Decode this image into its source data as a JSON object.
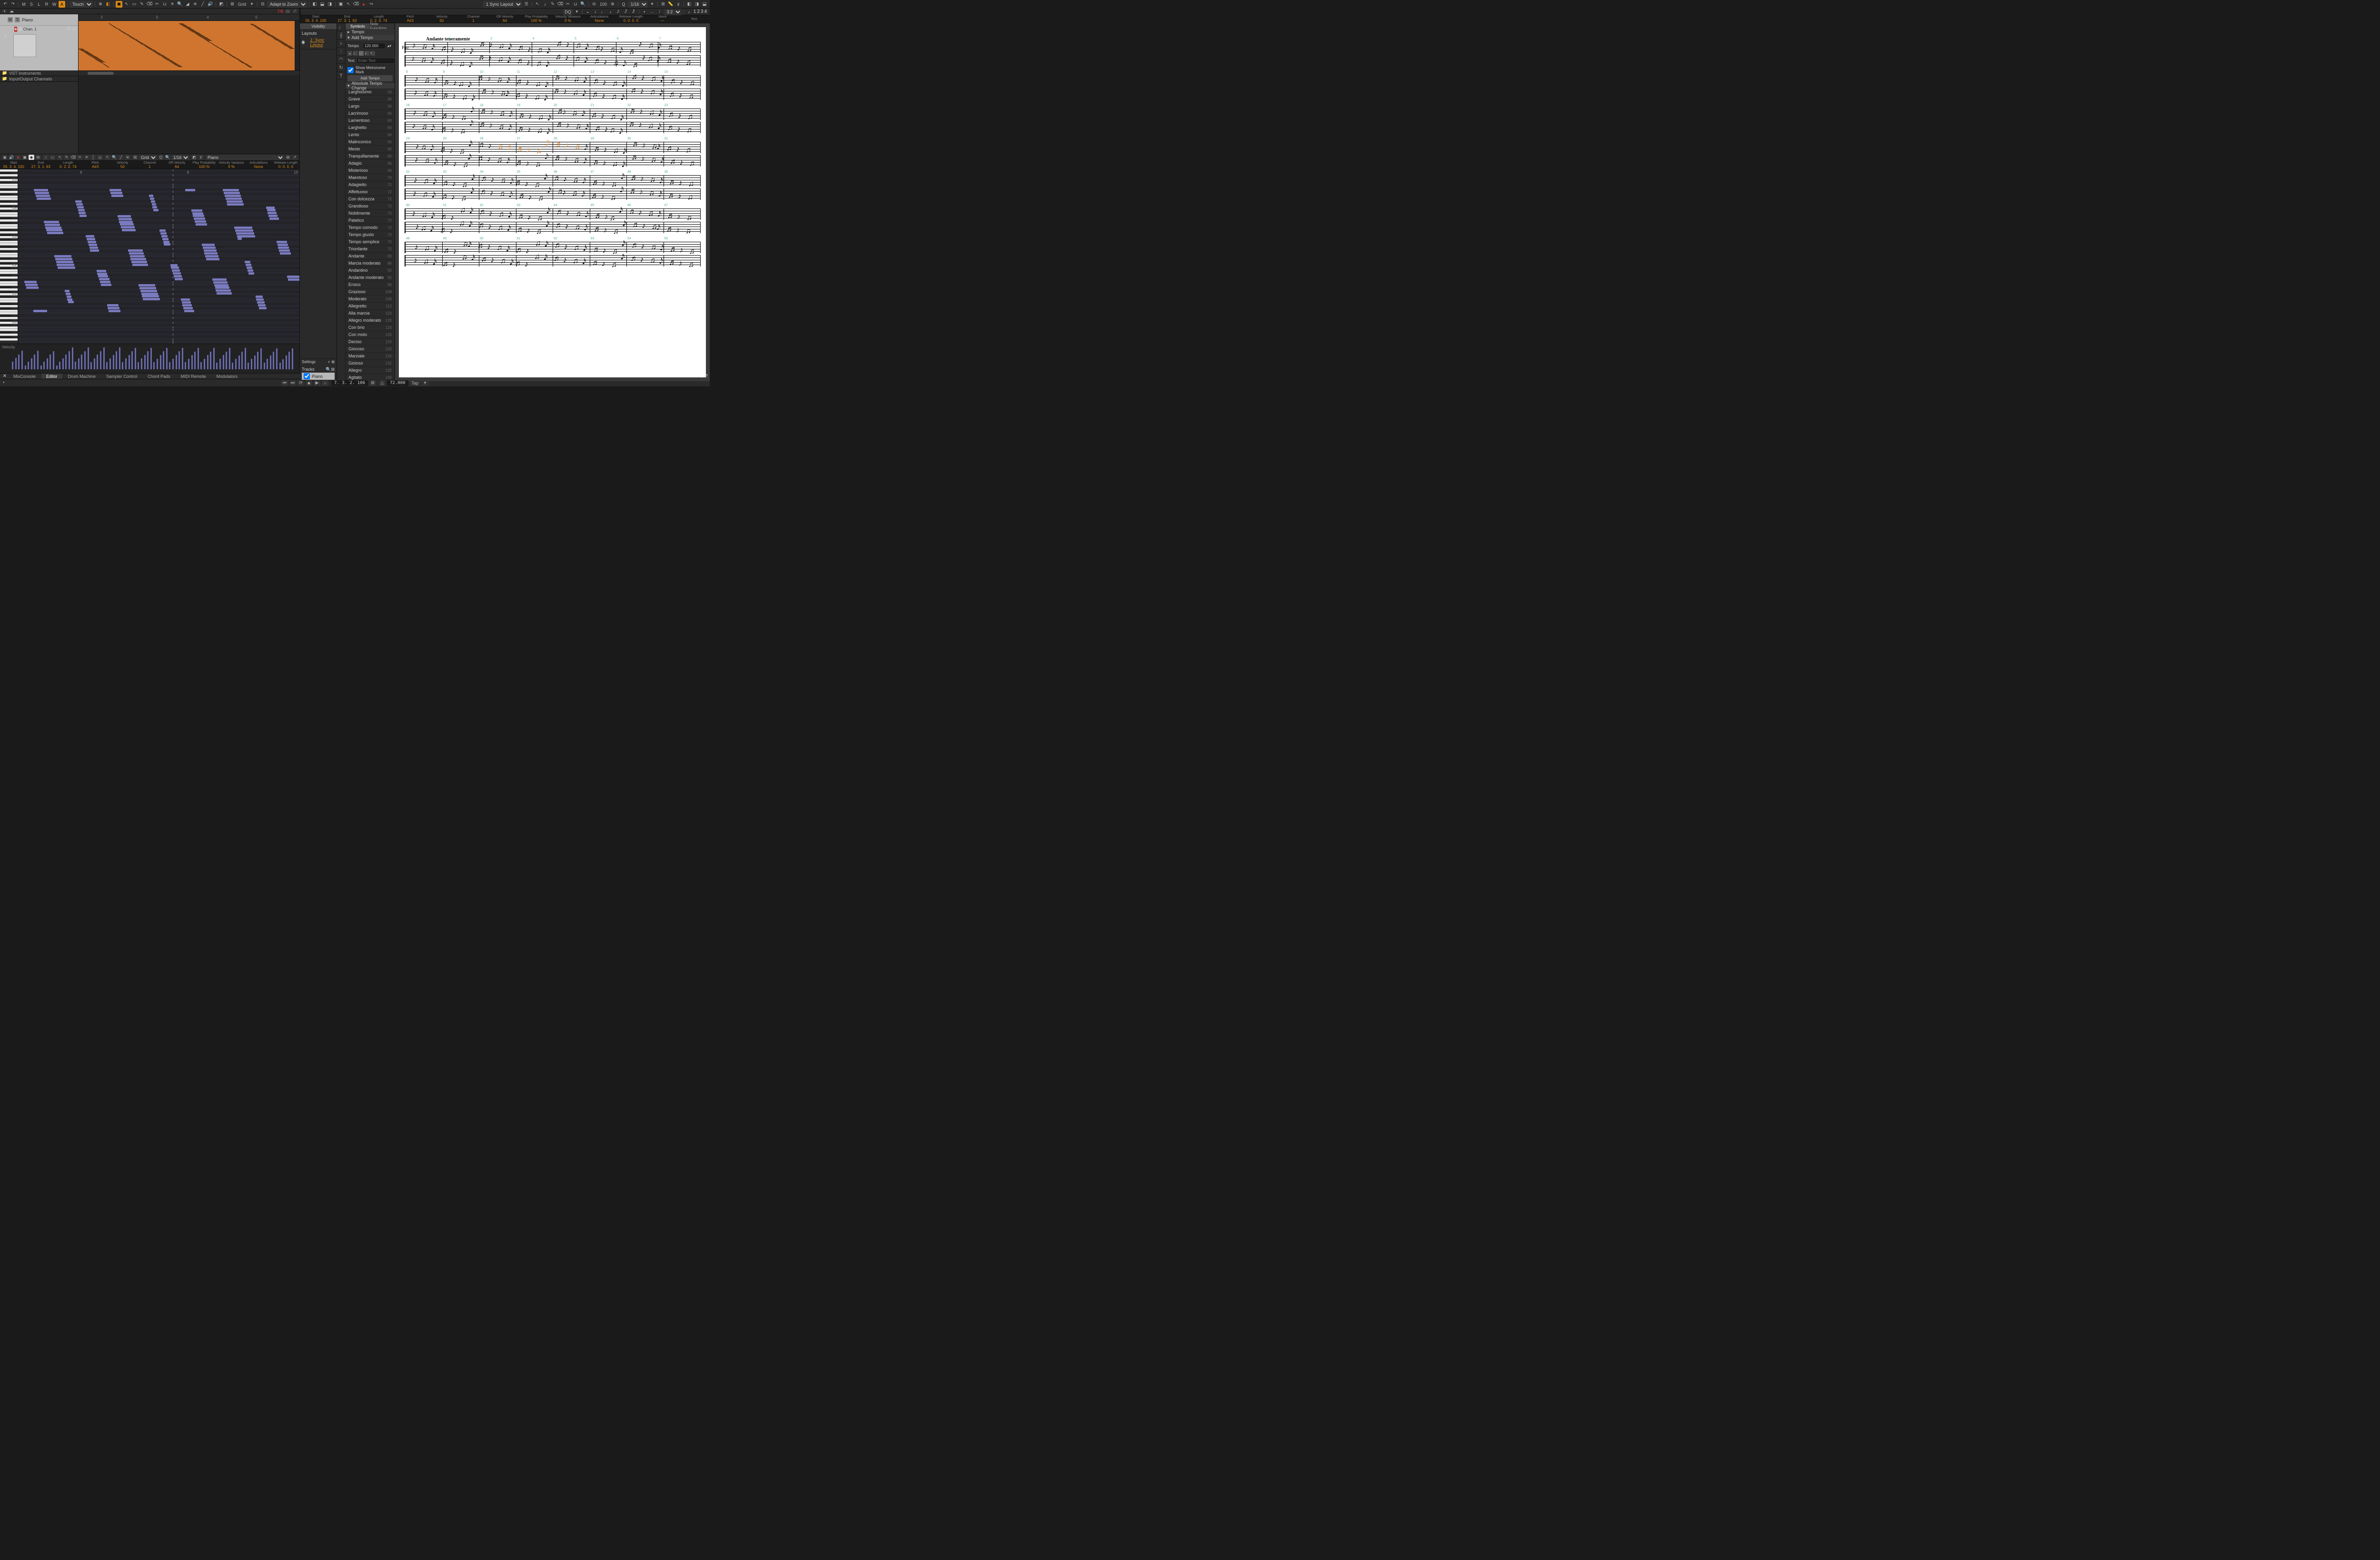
{
  "toolbar_top": {
    "automation_mode": "Touch",
    "grid_label": "Grid",
    "adapt_zoom": "Adapt to Zoom",
    "sync_layout": "1 Sync Layout",
    "zoom_pct": "100",
    "quantize": "1/16",
    "dq_label": "DQ",
    "triplet": "3:2",
    "voices": [
      "1",
      "2",
      "3",
      "4"
    ]
  },
  "arranger": {
    "time_sig": "7/8",
    "track_name": "Piano",
    "channel": "Chan. 1",
    "folders": [
      "VST Instruments",
      "Input/Output Channels"
    ],
    "ruler_marks": [
      "2",
      "3",
      "4",
      "5"
    ]
  },
  "key_editor": {
    "grid_label": "Grid",
    "quantize": "1/16",
    "track_sel": "Piano",
    "info": [
      {
        "lbl": "Start",
        "val": "26.  3.  4. 100"
      },
      {
        "lbl": "End",
        "val": "27.  3.  1.  63"
      },
      {
        "lbl": "Length",
        "val": "0.  2.  0.  74"
      },
      {
        "lbl": "Pitch",
        "val": "A#3"
      },
      {
        "lbl": "Velocity",
        "val": "50"
      },
      {
        "lbl": "Channel",
        "val": "1"
      },
      {
        "lbl": "Off Velocity",
        "val": "64"
      },
      {
        "lbl": "Play Probability",
        "val": "100 %"
      },
      {
        "lbl": "Velocity Variance",
        "val": "0 %"
      },
      {
        "lbl": "Articulations",
        "val": "None"
      },
      {
        "lbl": "Release Length",
        "val": "0.  0.  0.   0"
      }
    ],
    "octaves": [
      "C5",
      "C4",
      "C3",
      "C2",
      "C1",
      "C0"
    ],
    "ruler_marks": [
      "8",
      "9",
      "10"
    ],
    "velocity_label": "Velocity"
  },
  "score": {
    "info": [
      {
        "lbl": "Start",
        "val": "26.  3.  4. 100"
      },
      {
        "lbl": "End",
        "val": "27.  3.  1.  63"
      },
      {
        "lbl": "Length",
        "val": "0.  2.  0.  74"
      },
      {
        "lbl": "Pitch",
        "val": "A#3"
      },
      {
        "lbl": "Velocity",
        "val": "50"
      },
      {
        "lbl": "Channel",
        "val": "1"
      },
      {
        "lbl": "Off Velocity",
        "val": "64"
      },
      {
        "lbl": "Play Probability",
        "val": "100 %"
      },
      {
        "lbl": "Velocity Variance",
        "val": "0 %"
      },
      {
        "lbl": "Articulations",
        "val": "None"
      },
      {
        "lbl": "Release Length",
        "val": "0.  0.  0.   0"
      },
      {
        "lbl": "Voice",
        "val": "—"
      },
      {
        "lbl": "Text",
        "val": ""
      }
    ],
    "left": {
      "tab_visibility": "Visibility",
      "tab_symbols": "Symbols",
      "tab_notefn": "Note Functions",
      "layouts_label": "Layouts",
      "layout_current": "1: Sync Layout",
      "settings_label": "Settings",
      "tracks_label": "Tracks",
      "track_item": "Piano",
      "tempo_header": "Tempo",
      "add_tempo": "Add Tempo",
      "tempo_label": "Tempo",
      "tempo_value": "120.000",
      "text_label": "Text",
      "text_placeholder": "Enter Text",
      "show_metronome": "Show Metronome Mark",
      "add_tempo_btn": "Add Tempo",
      "abs_tempo_change": "Absolute Tempo Change"
    },
    "tempo_list": [
      {
        "name": "Larghissimo",
        "bpm": 24
      },
      {
        "name": "Grave",
        "bpm": 36
      },
      {
        "name": "Largo",
        "bpm": 56
      },
      {
        "name": "Lacrimoso",
        "bpm": 60
      },
      {
        "name": "Lamentoso",
        "bpm": 60
      },
      {
        "name": "Larghetto",
        "bpm": 60
      },
      {
        "name": "Lento",
        "bpm": 60
      },
      {
        "name": "Malinconico",
        "bpm": 60
      },
      {
        "name": "Mesto",
        "bpm": 60
      },
      {
        "name": "Tranquillamente",
        "bpm": 60
      },
      {
        "name": "Adagio",
        "bpm": 66
      },
      {
        "name": "Misterioso",
        "bpm": 66
      },
      {
        "name": "Maestoso",
        "bpm": 70
      },
      {
        "name": "Adagietto",
        "bpm": 72
      },
      {
        "name": "Affettuoso",
        "bpm": 72
      },
      {
        "name": "Con dolcezza",
        "bpm": 72
      },
      {
        "name": "Grandioso",
        "bpm": 72
      },
      {
        "name": "Nobilmente",
        "bpm": 72
      },
      {
        "name": "Patetico",
        "bpm": 72
      },
      {
        "name": "Tempo comodo",
        "bpm": 72
      },
      {
        "name": "Tempo giusto",
        "bpm": 72
      },
      {
        "name": "Tempo semplice",
        "bpm": 72
      },
      {
        "name": "Trionfante",
        "bpm": 72
      },
      {
        "name": "Andante",
        "bpm": 80
      },
      {
        "name": "Marcia moderato",
        "bpm": 86
      },
      {
        "name": "Andantino",
        "bpm": 92
      },
      {
        "name": "Andante moderato",
        "bpm": 92
      },
      {
        "name": "Eroico",
        "bpm": 96
      },
      {
        "name": "Grazioso",
        "bpm": 108
      },
      {
        "name": "Moderato",
        "bpm": 108
      },
      {
        "name": "Allegretto",
        "bpm": 112
      },
      {
        "name": "Alla marcia",
        "bpm": 120
      },
      {
        "name": "Allegro moderato",
        "bpm": 120
      },
      {
        "name": "Con brio",
        "bpm": 120
      },
      {
        "name": "Con moto",
        "bpm": 120
      },
      {
        "name": "Deciso",
        "bpm": 120
      },
      {
        "name": "Giocoso",
        "bpm": 120
      },
      {
        "name": "Marziale",
        "bpm": 120
      },
      {
        "name": "Gioioso",
        "bpm": 132
      },
      {
        "name": "Allegro",
        "bpm": 132
      },
      {
        "name": "Agitato",
        "bpm": 140
      }
    ],
    "page": {
      "tempo_marking": "Andante teneramente",
      "instrument": "Pno",
      "systems": [
        {
          "first_bar": 1,
          "bars": 7
        },
        {
          "first_bar": 8,
          "bars": 8
        },
        {
          "first_bar": 16,
          "bars": 8
        },
        {
          "first_bar": 24,
          "bars": 8
        },
        {
          "first_bar": 32,
          "bars": 8
        },
        {
          "first_bar": 40,
          "bars": 8
        },
        {
          "first_bar": 48,
          "bars": 8
        }
      ]
    }
  },
  "bottom_tabs": [
    "MixConsole",
    "Editor",
    "Drum Machine",
    "Sampler Control",
    "Chord Pads",
    "MIDI Remote",
    "Modulators"
  ],
  "bottom_tabs_active": 1,
  "transport": {
    "position": "7.  3.  2. 106",
    "tempo": "72.000",
    "tap": "Tap"
  }
}
